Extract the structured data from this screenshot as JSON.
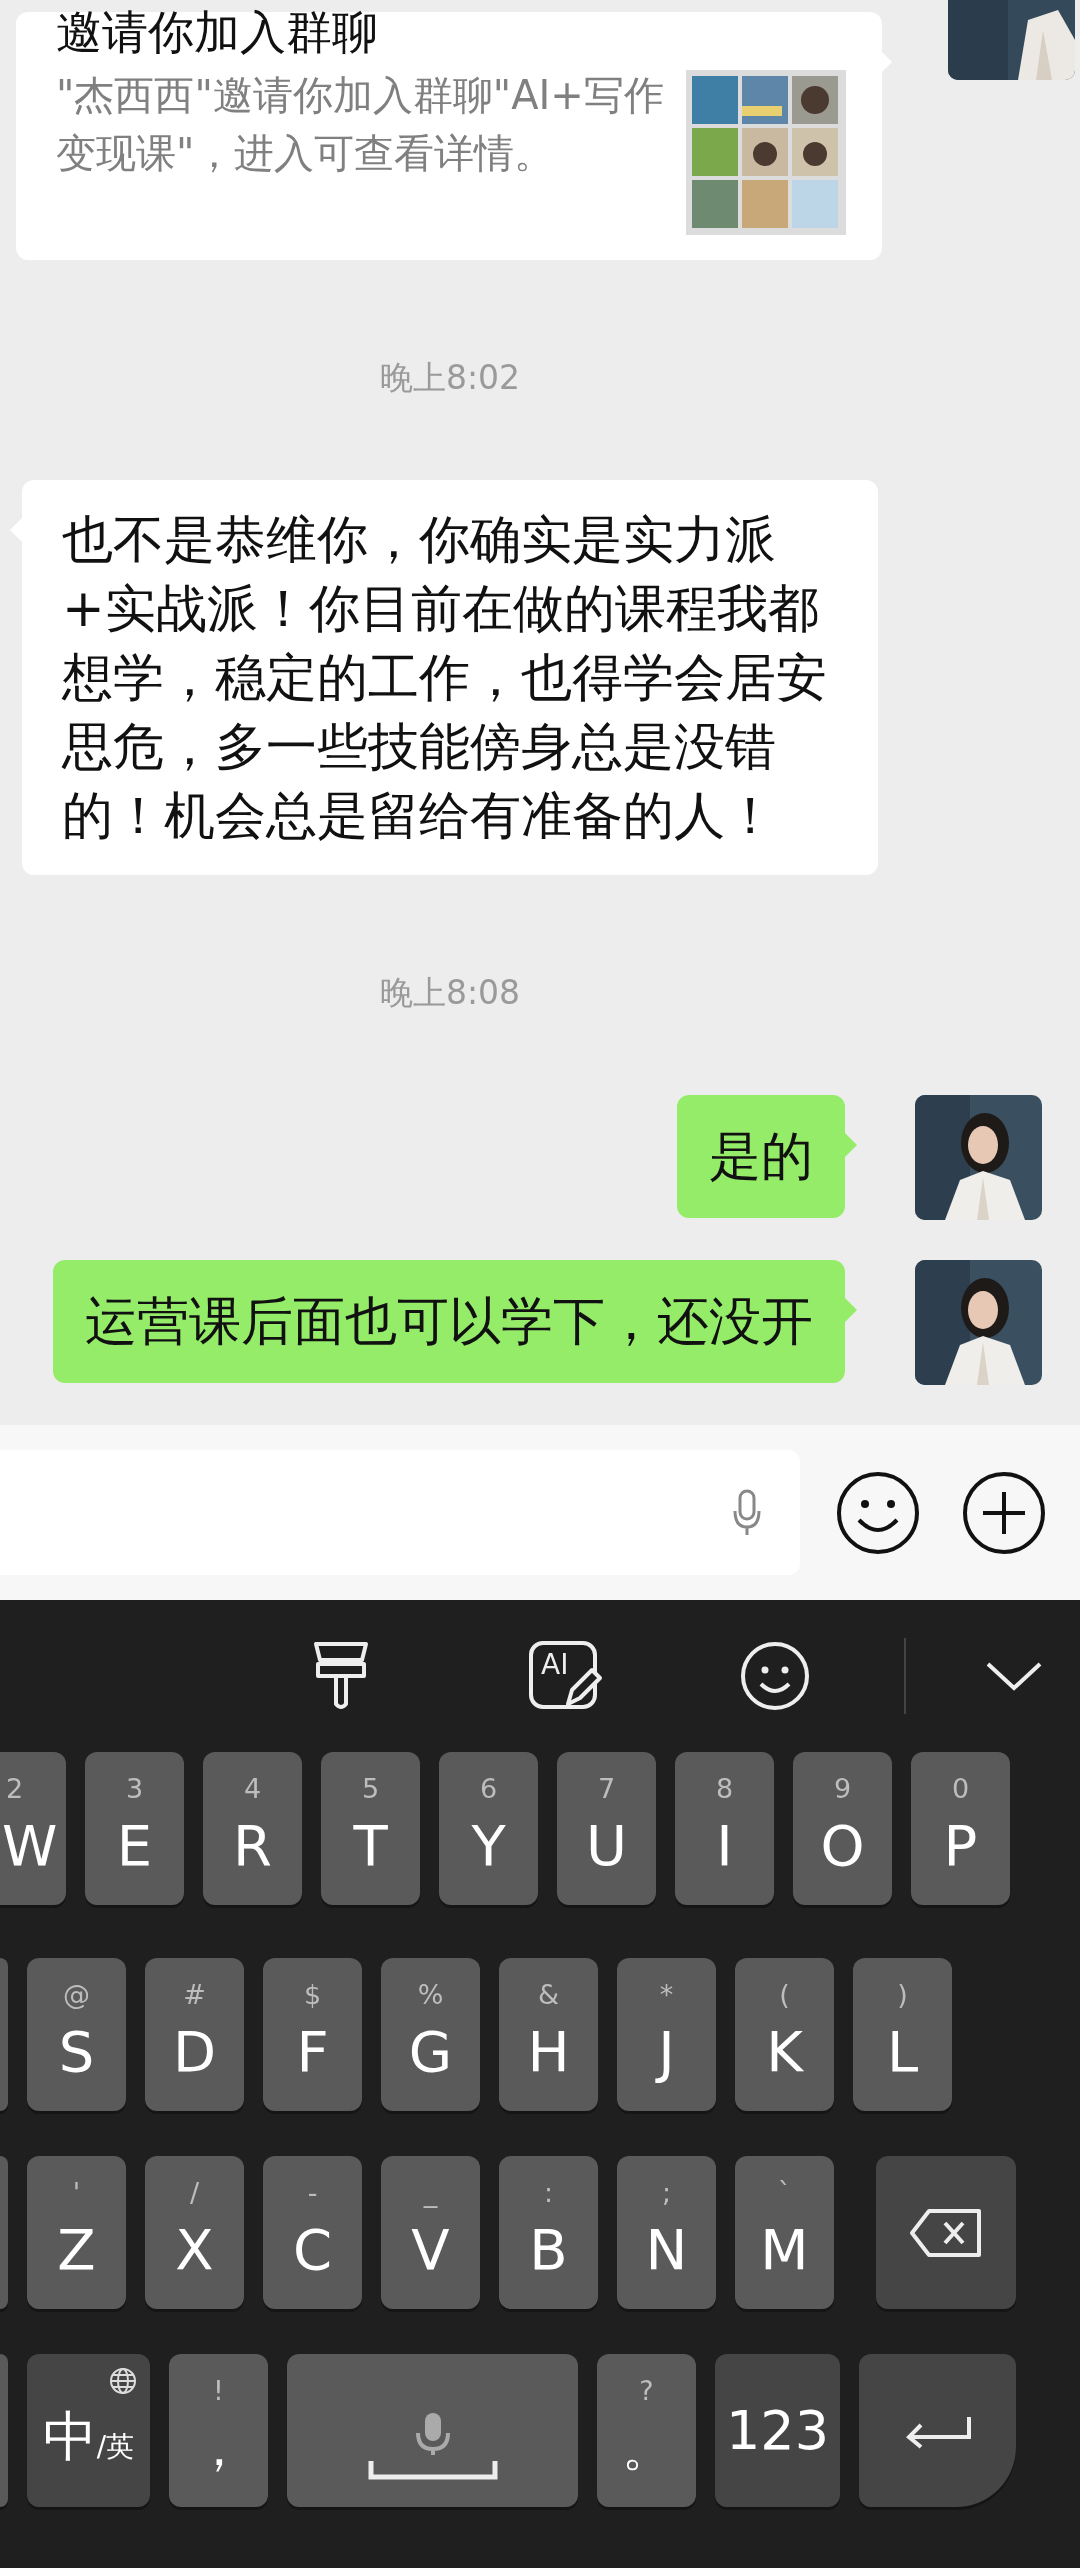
{
  "messages": [
    {
      "kind": "invite_sent",
      "title": "邀请你加入群聊",
      "text": "\"杰西西\"邀请你加入群聊\"AI+写作变现课\"，进入可查看详情。"
    },
    {
      "kind": "time",
      "text": "晚上8:02"
    },
    {
      "kind": "text_received",
      "text": "也不是恭维你，你确实是实力派+实战派！你目前在做的课程我都想学，稳定的工作，也得学会居安思危，多一些技能傍身总是没错的！机会总是留给有准备的人！"
    },
    {
      "kind": "time",
      "text": "晚上8:08"
    },
    {
      "kind": "text_sent",
      "text": "是的"
    },
    {
      "kind": "text_sent",
      "text": "运营课后面也可以学下，还没开"
    }
  ],
  "keyboard": {
    "ai_badge": "AI",
    "rows": [
      {
        "keys": [
          {
            "kind": "cut",
            "label": "W",
            "hint": "2"
          },
          {
            "kind": "char",
            "label": "E",
            "hint": "3"
          },
          {
            "kind": "char",
            "label": "R",
            "hint": "4"
          },
          {
            "kind": "char",
            "label": "T",
            "hint": "5"
          },
          {
            "kind": "char",
            "label": "Y",
            "hint": "6"
          },
          {
            "kind": "char",
            "label": "U",
            "hint": "7"
          },
          {
            "kind": "char",
            "label": "I",
            "hint": "8"
          },
          {
            "kind": "char",
            "label": "O",
            "hint": "9"
          },
          {
            "kind": "char",
            "label": "P",
            "hint": "0"
          }
        ]
      },
      {
        "keys": [
          {
            "kind": "sliver"
          },
          {
            "kind": "char",
            "label": "S",
            "hint": "@"
          },
          {
            "kind": "char",
            "label": "D",
            "hint": "#"
          },
          {
            "kind": "char",
            "label": "F",
            "hint": "$"
          },
          {
            "kind": "char",
            "label": "G",
            "hint": "%"
          },
          {
            "kind": "char",
            "label": "H",
            "hint": "&"
          },
          {
            "kind": "char",
            "label": "J",
            "hint": "*"
          },
          {
            "kind": "char",
            "label": "K",
            "hint": "("
          },
          {
            "kind": "char",
            "label": "L",
            "hint": ")"
          }
        ]
      },
      {
        "keys": [
          {
            "kind": "sliver"
          },
          {
            "kind": "char",
            "label": "Z",
            "hint": "'"
          },
          {
            "kind": "char",
            "label": "X",
            "hint": "/"
          },
          {
            "kind": "char",
            "label": "C",
            "hint": "-"
          },
          {
            "kind": "char",
            "label": "V",
            "hint": "_"
          },
          {
            "kind": "char",
            "label": "B",
            "hint": ":"
          },
          {
            "kind": "char",
            "label": "N",
            "hint": ";"
          },
          {
            "kind": "char",
            "label": "M",
            "hint": "`"
          },
          {
            "kind": "backspace"
          }
        ]
      },
      {
        "keys": [
          {
            "kind": "sliver"
          },
          {
            "kind": "lang",
            "label": "中",
            "sub": "/英"
          },
          {
            "kind": "punct",
            "label": "，",
            "hint": "!"
          },
          {
            "kind": "space"
          },
          {
            "kind": "punct",
            "label": "。",
            "hint": "?"
          },
          {
            "kind": "num",
            "label": "123"
          },
          {
            "kind": "enter"
          }
        ]
      }
    ]
  }
}
